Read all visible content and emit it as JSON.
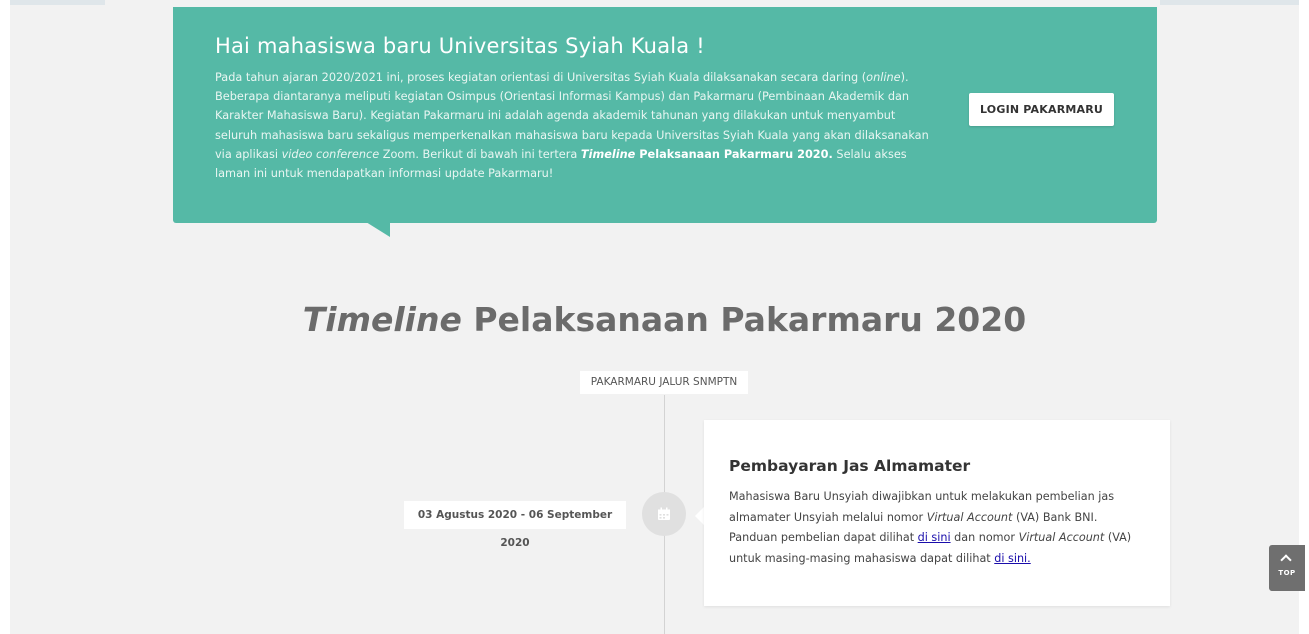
{
  "banner": {
    "heading": "Hai mahasiswa baru Universitas Syiah Kuala !",
    "p_1": "Pada tahun ajaran 2020/2021 ini, proses kegiatan orientasi di Universitas Syiah Kuala dilaksanakan secara daring (",
    "p_1_em": "online",
    "p_2": "). Beberapa diantaranya meliputi kegiatan Osimpus (Orientasi Informasi Kampus) dan Pakarmaru (Pembinaan Akademik dan Karakter Mahasiswa Baru). Kegiatan Pakarmaru ini adalah agenda akademik tahunan yang dilakukan untuk menyambut seluruh mahasiswa baru sekaligus memperkenalkan mahasiswa baru kepada Universitas Syiah Kuala yang akan dilaksanakan via aplikasi ",
    "p_2_em": "video conference",
    "p_3": " Zoom. Berikut di bawah ini tertera ",
    "p_3_strong_em": "Timeline",
    "p_3_strong": " Pelaksanaan Pakarmaru 2020.",
    "p_4": " Selalu akses laman ini untuk mendapatkan informasi update Pakarmaru!",
    "login_label": "LOGIN PAKARMARU"
  },
  "timeline": {
    "title_em": "Timeline",
    "title_rest": " Pelaksanaan Pakarmaru 2020",
    "category": "PAKARMARU JALUR SNMPTN",
    "items": [
      {
        "date": "03 Agustus 2020 - 06 September 2020",
        "icon": "calendar-icon",
        "title": "Pembayaran Jas Almamater",
        "t1": "Mahasiswa Baru Unsyiah diwajibkan untuk melakukan pembelian jas almamater Unsyiah melalui nomor ",
        "t1_em": "Virtual Account",
        "t2": " (VA) Bank BNI. Panduan pembelian dapat dilihat ",
        "link1": "di sini",
        "t3": " dan nomor ",
        "t3_em": "Virtual Account",
        "t4": " (VA) untuk masing-masing mahasiswa dapat dilihat ",
        "link2": "di sini."
      }
    ]
  },
  "scroll_top": {
    "label": "TOP",
    "icon": "chevron-up-icon"
  },
  "colors": {
    "banner": "#55b9a6",
    "page_bg": "#f2f2f2",
    "title": "#6b6b6b",
    "top_button": "#6f6f6f"
  }
}
